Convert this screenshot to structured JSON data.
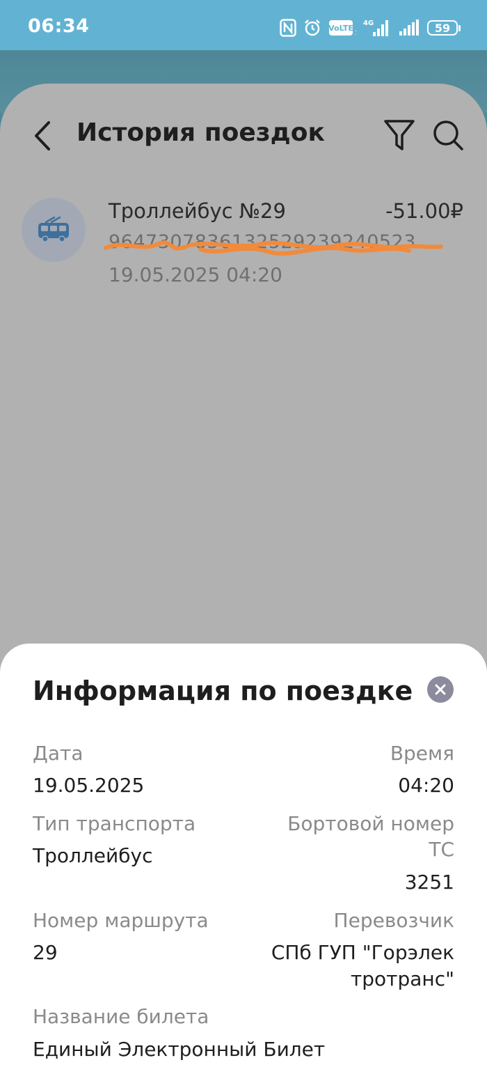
{
  "status_bar": {
    "time": "06:34",
    "battery": "59",
    "network": "4G",
    "volte": "VoLTE"
  },
  "header": {
    "title": "История поездок"
  },
  "trips": [
    {
      "name": "Троллейбус №29",
      "amount": "-51.00₽",
      "card_number": "9647307836132529239240523",
      "datetime": "19.05.2025 04:20",
      "icon": "trolleybus-icon"
    }
  ],
  "sheet": {
    "title": "Информация по поездке",
    "date_label": "Дата",
    "date_value": "19.05.2025",
    "time_label": "Время",
    "time_value": "04:20",
    "transport_type_label": "Тип транспорта",
    "transport_type_value": "Троллейбус",
    "board_number_label_line1": "Бортовой номер",
    "board_number_label_line2": "ТС",
    "board_number_value": "3251",
    "route_label": "Номер маршрута",
    "route_value": "29",
    "carrier_label": "Перевозчик",
    "carrier_value_line1": "СПб ГУП \"Горэлек",
    "carrier_value_line2": "тротранс\"",
    "ticket_label": "Название билета",
    "ticket_value": "Единый Электронный Билет"
  },
  "colors": {
    "status_bar": "#62b3d3",
    "overlay_card": "#b1b1b1",
    "accent_scribble": "#f28a3b",
    "trolleybus_icon": "#3f6f9c"
  }
}
